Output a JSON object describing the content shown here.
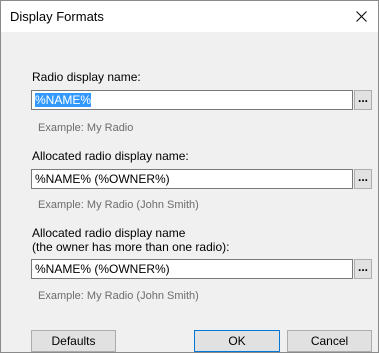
{
  "window": {
    "title": "Display Formats",
    "close_icon": "close-icon"
  },
  "fields": [
    {
      "label": "Radio display name:",
      "value": "%NAME%",
      "value_selected": true,
      "browse_label": "...",
      "example": "Example: My Radio"
    },
    {
      "label": "Allocated radio display name:",
      "value": "%NAME% (%OWNER%)",
      "value_selected": false,
      "browse_label": "...",
      "example": "Example: My Radio (John Smith)"
    },
    {
      "label_line1": "Allocated radio display name",
      "label_line2": "(the owner has more than one radio):",
      "value": "%NAME% (%OWNER%)",
      "value_selected": false,
      "browse_label": "...",
      "example": "Example: My Radio (John Smith)"
    }
  ],
  "buttons": {
    "defaults": "Defaults",
    "ok": "OK",
    "cancel": "Cancel"
  },
  "colors": {
    "selection": "#3399ff",
    "default_button_border": "#0078d7",
    "example_text": "#6d6d6d"
  }
}
